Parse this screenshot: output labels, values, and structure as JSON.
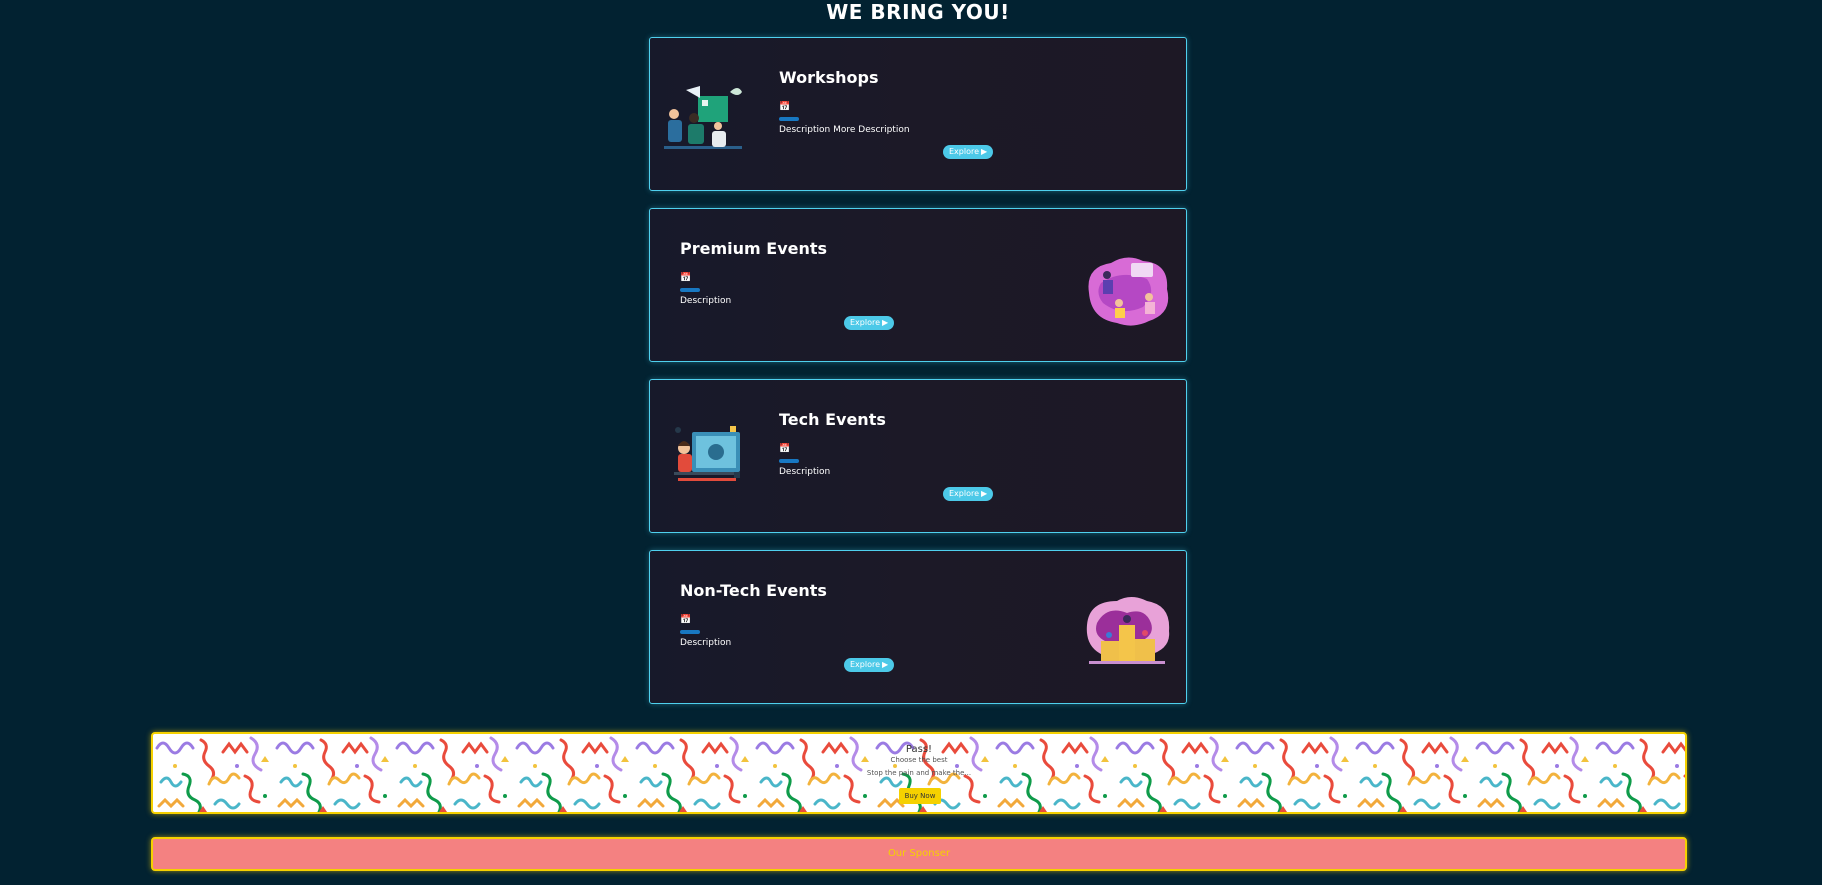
{
  "page": {
    "title": "WE BRING YOU!"
  },
  "cards": [
    {
      "title": "Workshops",
      "calendar_icon": "calendar-icon",
      "description": "Description More Description",
      "button_label": "Explore",
      "button_icon": "play-icon",
      "image": "workshop-illustration"
    },
    {
      "title": "Premium Events",
      "calendar_icon": "calendar-icon",
      "description": "Description",
      "button_label": "Explore",
      "button_icon": "play-icon",
      "image": "premium-events-illustration"
    },
    {
      "title": "Tech Events",
      "calendar_icon": "calendar-icon",
      "description": "Description",
      "button_label": "Explore",
      "button_icon": "play-icon",
      "image": "tech-events-illustration"
    },
    {
      "title": "Non-Tech Events",
      "calendar_icon": "calendar-icon",
      "description": "Description",
      "button_label": "Explore",
      "button_icon": "play-icon",
      "image": "non-tech-events-illustration"
    }
  ],
  "pass": {
    "title": "Pass!",
    "subtitle": "Choose the best",
    "tagline": "Stop the pain and make the...",
    "button_label": "Buy Now"
  },
  "sponsor": {
    "label": "Our Sponser"
  },
  "colors": {
    "background": "#022231",
    "card_border": "#4fd0ee",
    "button": "#4cc9e8",
    "accent_bar": "#1878c2",
    "banner_border": "#f5d100",
    "sponsor_bg": "#f48181"
  }
}
